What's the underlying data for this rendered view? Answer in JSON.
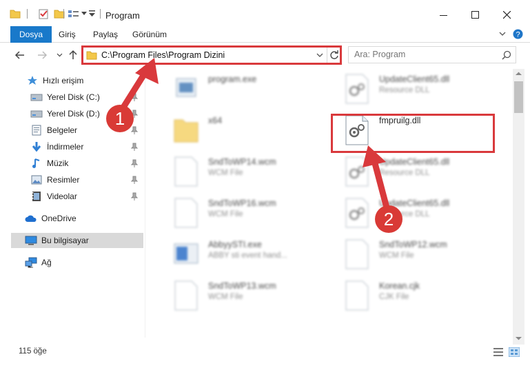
{
  "window": {
    "title": "Program",
    "minimize_icon": "minimize-icon",
    "maximize_icon": "maximize-icon",
    "close_icon": "close-icon"
  },
  "ribbon": {
    "tabs": [
      {
        "label": "Dosya"
      },
      {
        "label": "Giriş"
      },
      {
        "label": "Paylaş"
      },
      {
        "label": "Görünüm"
      }
    ]
  },
  "nav": {
    "address": "C:\\Program Files\\Program Dizini",
    "search_placeholder": "Ara: Program"
  },
  "sidebar": {
    "items": [
      {
        "label": "Hızlı erişim",
        "icon": "star-icon"
      },
      {
        "label": "Yerel Disk (C:)",
        "icon": "drive-icon"
      },
      {
        "label": "Yerel Disk (D:)",
        "icon": "drive-icon"
      },
      {
        "label": "Belgeler",
        "icon": "documents-icon"
      },
      {
        "label": "İndirmeler",
        "icon": "download-icon"
      },
      {
        "label": "Müzik",
        "icon": "music-icon"
      },
      {
        "label": "Resimler",
        "icon": "pictures-icon"
      },
      {
        "label": "Videolar",
        "icon": "videos-icon"
      },
      {
        "label": "OneDrive",
        "icon": "cloud-icon"
      },
      {
        "label": "Bu bilgisayar",
        "icon": "computer-icon"
      },
      {
        "label": "Ağ",
        "icon": "network-icon"
      }
    ]
  },
  "files": [
    {
      "name": "program.exe",
      "type": ""
    },
    {
      "name": "UpdateClient65.dll",
      "type": "Resource DLL"
    },
    {
      "name": "x64",
      "type": ""
    },
    {
      "name": "fmpruilg.dll",
      "type": ""
    },
    {
      "name": "SndToWP14.wcm",
      "type": "WCM File"
    },
    {
      "name": "UpdateClient65.dll",
      "type": "Resource DLL"
    },
    {
      "name": "SndToWP16.wcm",
      "type": "WCM File"
    },
    {
      "name": "UpdateClient65.dll",
      "type": "Resource DLL"
    },
    {
      "name": "AbbyySTI.exe",
      "type": "ABBY sti event hand..."
    },
    {
      "name": "SndToWP12.wcm",
      "type": "WCM File"
    },
    {
      "name": "SndToWP13.wcm",
      "type": "WCM File"
    },
    {
      "name": "Korean.cjk",
      "type": "CJK File"
    }
  ],
  "status": {
    "count": "115 öğe"
  },
  "annotations": {
    "step1": "1",
    "step2": "2",
    "color": "#d9393c"
  }
}
